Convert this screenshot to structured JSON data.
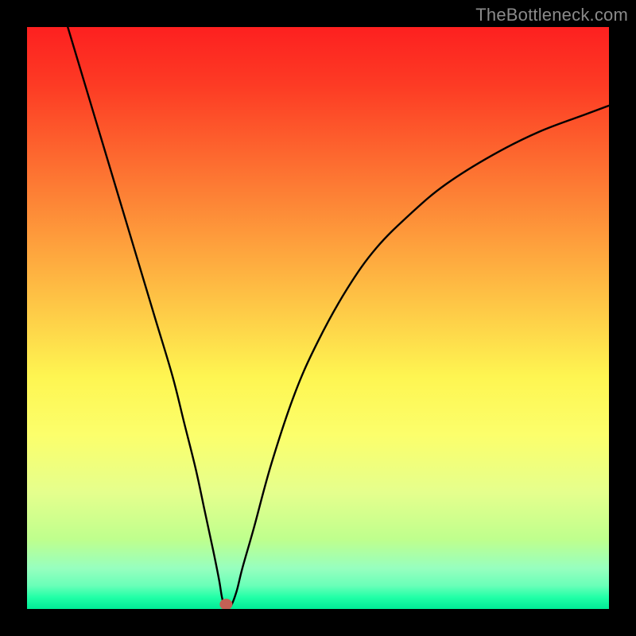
{
  "watermark": "TheBottleneck.com",
  "chart_data": {
    "type": "line",
    "title": "",
    "xlabel": "",
    "ylabel": "",
    "xlim": [
      0,
      100
    ],
    "ylim": [
      0,
      100
    ],
    "x": [
      7,
      10,
      13,
      16,
      19,
      22,
      25,
      27,
      29,
      30.5,
      32,
      33,
      33.5,
      34,
      35,
      36,
      37,
      39,
      42,
      46,
      50,
      55,
      60,
      66,
      72,
      80,
      88,
      96,
      100
    ],
    "values": [
      100,
      90,
      80,
      70,
      60,
      50,
      40,
      32,
      24,
      17,
      10,
      5,
      2,
      0.5,
      0.5,
      3,
      7,
      14,
      25,
      37,
      46,
      55,
      62,
      68,
      73,
      78,
      82,
      85,
      86.5
    ],
    "marker": {
      "x": 34.2,
      "y": 0.8,
      "color": "#c46055"
    },
    "background": "rainbow_vertical"
  }
}
